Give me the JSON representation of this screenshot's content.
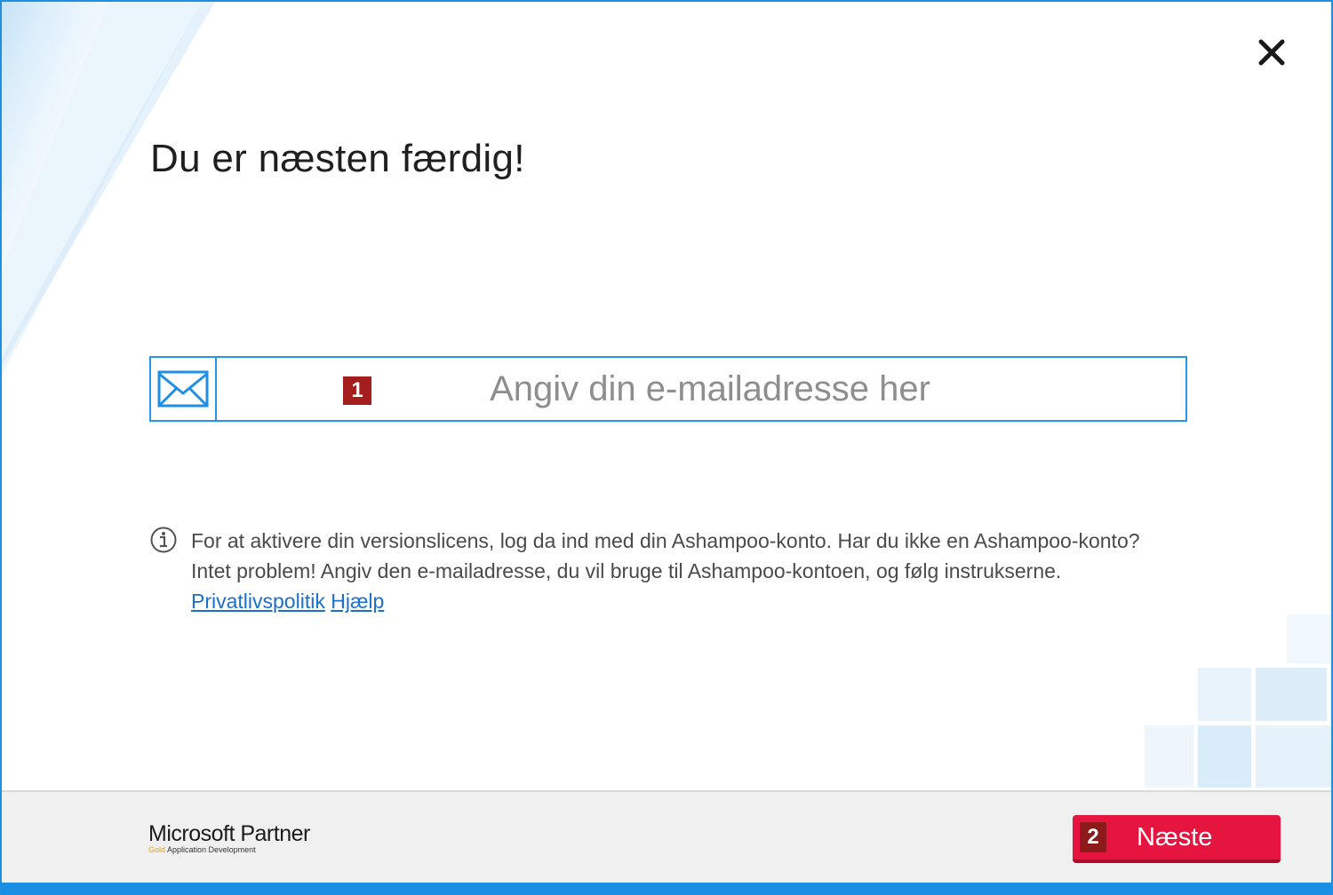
{
  "dialog": {
    "title": "Du er næsten færdig!",
    "close_icon": "close-icon"
  },
  "email": {
    "placeholder": "Angiv din e-mailadresse her",
    "value": "",
    "icon": "envelope-icon",
    "step_badge": "1"
  },
  "info": {
    "icon": "info-icon",
    "text": "For at aktivere din versionslicens, log da ind med din Ashampoo-konto. Har du ikke en Ashampoo-konto? Intet problem! Angiv den e-mailadresse, du vil bruge til Ashampoo-kontoen, og følg instrukserne.",
    "privacy_link": "Privatlivspolitik",
    "help_link": "Hjælp"
  },
  "footer": {
    "partner_title": "Microsoft Partner",
    "partner_gold": "Gold",
    "partner_sub": "Application Development",
    "next_badge": "2",
    "next_label": "Næste"
  },
  "colors": {
    "accent_blue": "#1f8fe6",
    "next_red": "#e5153f",
    "badge_red": "#a51e1e"
  }
}
